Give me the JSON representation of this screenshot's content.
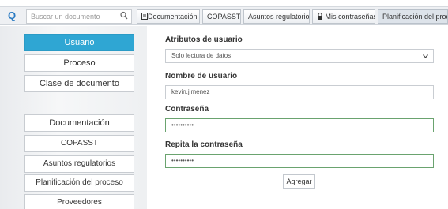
{
  "topbar": {
    "logo_glyph": "Q",
    "search_placeholder": "Buscar un documento",
    "nav": [
      {
        "label": "Documentación"
      },
      {
        "label": "COPASST"
      },
      {
        "label": "Asuntos regulatorios"
      },
      {
        "label": "Mis contraseñas"
      },
      {
        "label": "Planificación del proceso"
      }
    ]
  },
  "sidebar": {
    "items": [
      {
        "label": "Usuario"
      },
      {
        "label": "Proceso"
      },
      {
        "label": "Clase de documento"
      },
      {
        "label": "Documentación"
      },
      {
        "label": "COPASST"
      },
      {
        "label": "Asuntos regulatorios"
      },
      {
        "label": "Planificación del proceso"
      },
      {
        "label": "Proveedores"
      }
    ],
    "active_color": "#2fa6d3"
  },
  "form": {
    "attributes_label": "Atributos de usuario",
    "attributes_value": "Solo lectura de datos",
    "username_label": "Nombre de usuario",
    "username_value": "kevin.jimenez",
    "password_label": "Contraseña",
    "password_value": "••••••••••",
    "repeat_label": "Repita la contraseña",
    "repeat_value": "••••••••••",
    "submit_label": "Agregar"
  }
}
